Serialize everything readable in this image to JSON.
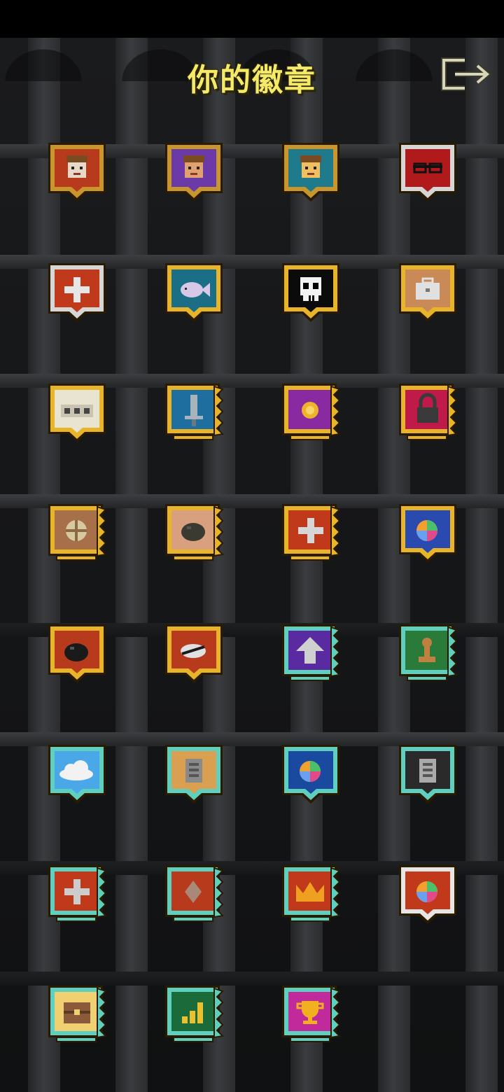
{
  "header": {
    "title": "你的徽章",
    "exit_icon": "exit-icon"
  },
  "badges": [
    {
      "icon": "warrior-portrait-icon",
      "border": "#c9962e",
      "fill": "#b83a1c",
      "glyph": "face",
      "glyphColor": "#e8d8c8",
      "shape": "shield"
    },
    {
      "icon": "mage-portrait-icon",
      "border": "#c9962e",
      "fill": "#6b3aa8",
      "glyph": "face",
      "glyphColor": "#e0a070",
      "shape": "shield"
    },
    {
      "icon": "rogue-portrait-icon",
      "border": "#c9962e",
      "fill": "#1f7a8c",
      "glyph": "face",
      "glyphColor": "#f0c060",
      "shape": "shield"
    },
    {
      "icon": "glasses-portrait-icon",
      "border": "#d6d6d6",
      "fill": "#b01a1a",
      "glyph": "glasses",
      "glyphColor": "#111111",
      "shape": "shield"
    },
    {
      "icon": "health-cross-icon",
      "border": "#d6d6d6",
      "fill": "#c0391a",
      "glyph": "cross",
      "glyphColor": "#e6e6e6",
      "shape": "shield"
    },
    {
      "icon": "fish-icon",
      "border": "#e8b52a",
      "fill": "#1a6f86",
      "glyph": "fish",
      "glyphColor": "#d7c8e8",
      "shape": "shield"
    },
    {
      "icon": "skull-icon",
      "border": "#e8b52a",
      "fill": "#0b0b0b",
      "glyph": "skull",
      "glyphColor": "#f2f2f2",
      "shape": "shield"
    },
    {
      "icon": "chest-icon",
      "border": "#e8b52a",
      "fill": "#c98a58",
      "glyph": "box",
      "glyphColor": "#e0e0e0",
      "shape": "shield"
    },
    {
      "icon": "ellipsis-icon",
      "border": "#e8b52a",
      "fill": "#e9e3d2",
      "glyph": "dots",
      "glyphColor": "#444444",
      "shape": "shield"
    },
    {
      "icon": "sword-icon",
      "border": "#e8b52a",
      "fill": "#1e6fa0",
      "glyph": "sword",
      "glyphColor": "#a8b4bc",
      "shape": "scroll"
    },
    {
      "icon": "gold-coin-icon",
      "border": "#e8b52a",
      "fill": "#8a2aa0",
      "glyph": "coin",
      "glyphColor": "#f0b22a",
      "shape": "scroll"
    },
    {
      "icon": "padlock-icon",
      "border": "#e8b52a",
      "fill": "#c01a4a",
      "glyph": "lock",
      "glyphColor": "#3a3a3a",
      "shape": "scroll"
    },
    {
      "icon": "wheel-icon",
      "border": "#e8b52a",
      "fill": "#a8704a",
      "glyph": "wheel",
      "glyphColor": "#d8c8a0",
      "shape": "scroll"
    },
    {
      "icon": "stone-icon",
      "border": "#e8b52a",
      "fill": "#d9a080",
      "glyph": "rock",
      "glyphColor": "#3a3a30",
      "shape": "scroll"
    },
    {
      "icon": "health-cross-icon",
      "border": "#e8b52a",
      "fill": "#c0391a",
      "glyph": "cross",
      "glyphColor": "#d6d6d6",
      "shape": "scroll"
    },
    {
      "icon": "rainbow-orb-icon",
      "border": "#e8b52a",
      "fill": "#2a4ab0",
      "glyph": "orb",
      "glyphColor": "#f0a030",
      "shape": "shield"
    },
    {
      "icon": "bomb-icon",
      "border": "#e8b52a",
      "fill": "#b83a1c",
      "glyph": "rock",
      "glyphColor": "#1a1a1a",
      "shape": "shield"
    },
    {
      "icon": "bell-icon",
      "border": "#e8b52a",
      "fill": "#b83a1c",
      "glyph": "eye",
      "glyphColor": "#e0e0e0",
      "shape": "shield"
    },
    {
      "icon": "up-arrow-icon",
      "border": "#5fd0c0",
      "fill": "#5a2aa0",
      "glyph": "arrow",
      "glyphColor": "#d0d0d0",
      "shape": "scroll"
    },
    {
      "icon": "pawn-icon",
      "border": "#5fd0c0",
      "fill": "#2a7a3a",
      "glyph": "pawn",
      "glyphColor": "#c08040",
      "shape": "scroll"
    },
    {
      "icon": "cloud-icon",
      "border": "#5fd0c0",
      "fill": "#4aa8e8",
      "glyph": "cloud",
      "glyphColor": "#f2f2f2",
      "shape": "shield"
    },
    {
      "icon": "stone-tablet-icon",
      "border": "#5fd0c0",
      "fill": "#d8a050",
      "glyph": "tablet",
      "glyphColor": "#8a8a8a",
      "shape": "shield"
    },
    {
      "icon": "rainbow-orb-icon",
      "border": "#5fd0c0",
      "fill": "#1a4aa0",
      "glyph": "orb",
      "glyphColor": "#f0a030",
      "shape": "shield"
    },
    {
      "icon": "stone-tablet-icon",
      "border": "#5fd0c0",
      "fill": "#2a2a2a",
      "glyph": "tablet",
      "glyphColor": "#aaaaaa",
      "shape": "shield"
    },
    {
      "icon": "health-cross-icon",
      "border": "#5fd0c0",
      "fill": "#c0391a",
      "glyph": "cross",
      "glyphColor": "#cccccc",
      "shape": "scroll"
    },
    {
      "icon": "gem-icon",
      "border": "#5fd0c0",
      "fill": "#b83a1c",
      "glyph": "gem",
      "glyphColor": "#aa8878",
      "shape": "scroll"
    },
    {
      "icon": "crown-icon",
      "border": "#5fd0c0",
      "fill": "#c0391a",
      "glyph": "crown",
      "glyphColor": "#f0a020",
      "shape": "scroll"
    },
    {
      "icon": "rainbow-orb-icon",
      "border": "#e6e6e6",
      "fill": "#c0391a",
      "glyph": "orb",
      "glyphColor": "#f0a030",
      "shape": "shield"
    },
    {
      "icon": "treasure-chest-icon",
      "border": "#5fd0c0",
      "fill": "#f0d070",
      "glyph": "chest",
      "glyphColor": "#8a5a3a",
      "shape": "scroll"
    },
    {
      "icon": "bar-chart-icon",
      "border": "#5fd0c0",
      "fill": "#1a6a3a",
      "glyph": "bars",
      "glyphColor": "#e8c030",
      "shape": "scroll"
    },
    {
      "icon": "trophy-icon",
      "border": "#5fd0c0",
      "fill": "#c02a9a",
      "glyph": "trophy",
      "glyphColor": "#f0b020",
      "shape": "scroll"
    }
  ]
}
